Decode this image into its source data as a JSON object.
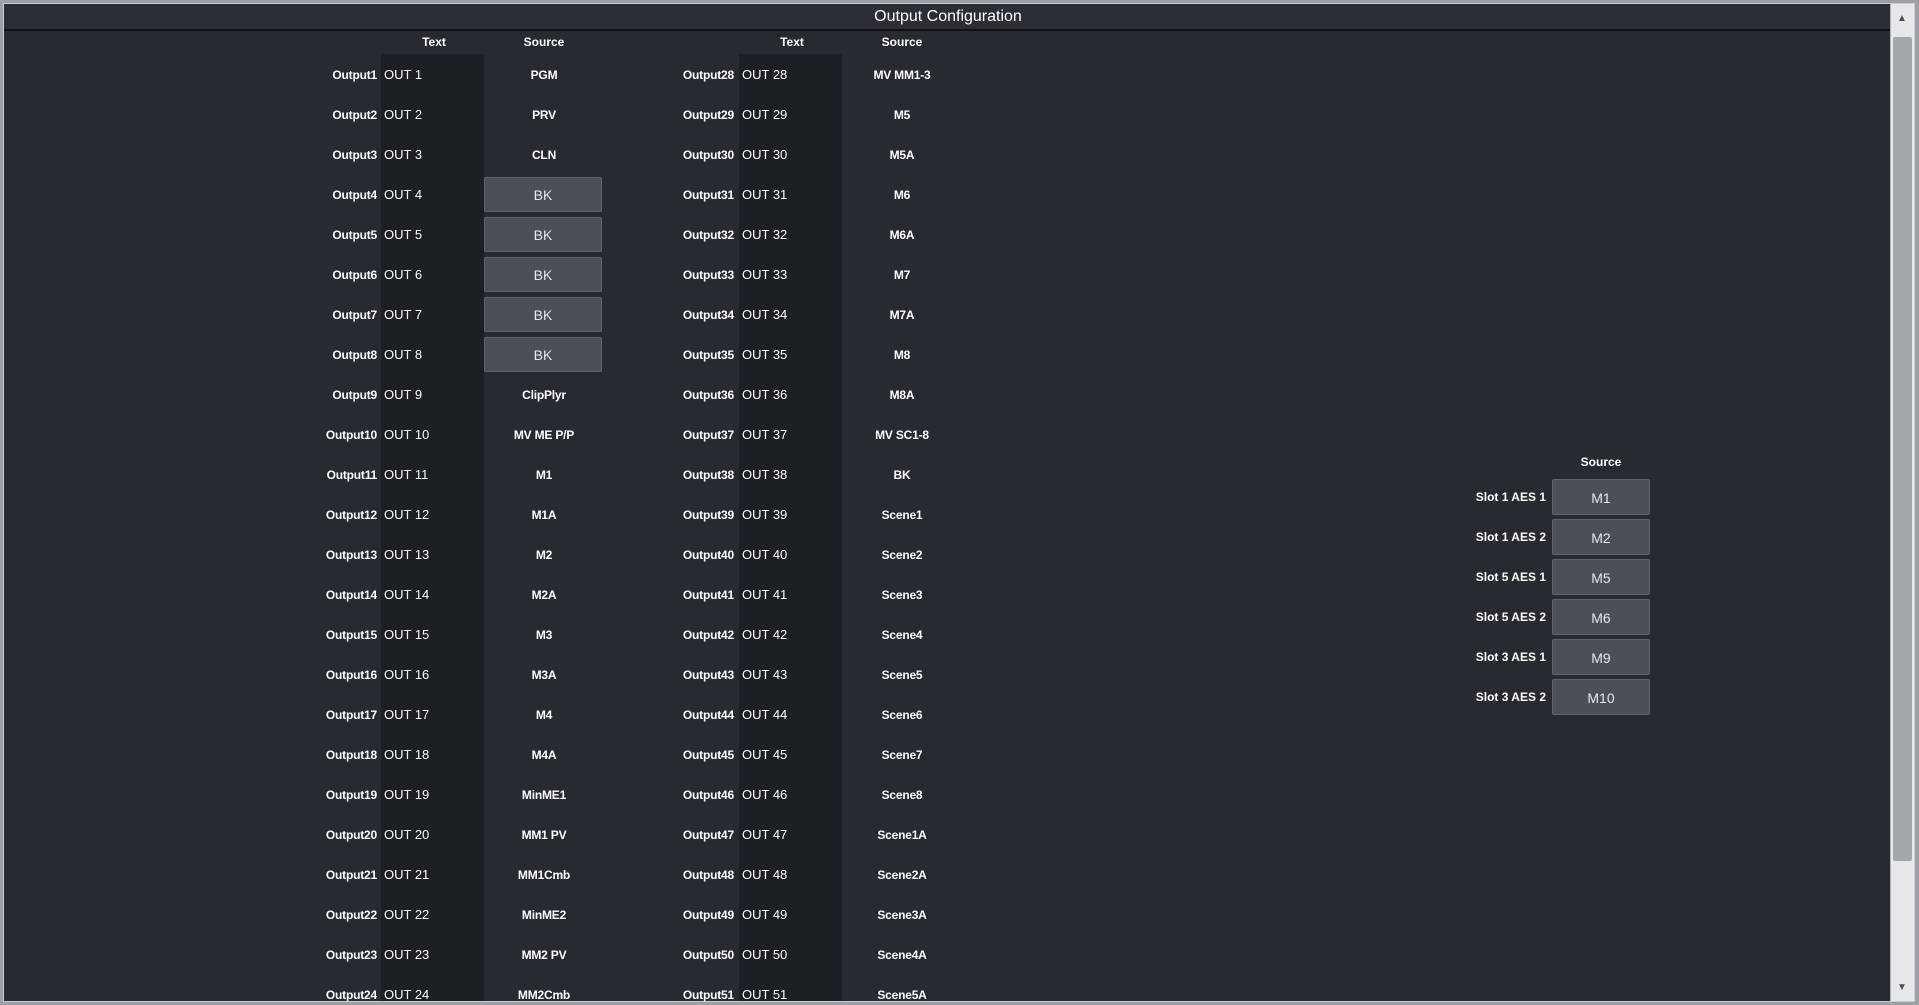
{
  "title": "Output Configuration",
  "columns": {
    "text": "Text",
    "source": "Source"
  },
  "outputsLeft": [
    {
      "label": "Output1",
      "text": "OUT 1",
      "source": "PGM",
      "button": false
    },
    {
      "label": "Output2",
      "text": "OUT 2",
      "source": "PRV",
      "button": false
    },
    {
      "label": "Output3",
      "text": "OUT 3",
      "source": "CLN",
      "button": false
    },
    {
      "label": "Output4",
      "text": "OUT 4",
      "source": "BK",
      "button": true
    },
    {
      "label": "Output5",
      "text": "OUT 5",
      "source": "BK",
      "button": true
    },
    {
      "label": "Output6",
      "text": "OUT 6",
      "source": "BK",
      "button": true
    },
    {
      "label": "Output7",
      "text": "OUT 7",
      "source": "BK",
      "button": true
    },
    {
      "label": "Output8",
      "text": "OUT 8",
      "source": "BK",
      "button": true
    },
    {
      "label": "Output9",
      "text": "OUT 9",
      "source": "ClipPlyr",
      "button": false
    },
    {
      "label": "Output10",
      "text": "OUT 10",
      "source": "MV ME P/P",
      "button": false
    },
    {
      "label": "Output11",
      "text": "OUT 11",
      "source": "M1",
      "button": false
    },
    {
      "label": "Output12",
      "text": "OUT 12",
      "source": "M1A",
      "button": false
    },
    {
      "label": "Output13",
      "text": "OUT 13",
      "source": "M2",
      "button": false
    },
    {
      "label": "Output14",
      "text": "OUT 14",
      "source": "M2A",
      "button": false
    },
    {
      "label": "Output15",
      "text": "OUT 15",
      "source": "M3",
      "button": false
    },
    {
      "label": "Output16",
      "text": "OUT 16",
      "source": "M3A",
      "button": false
    },
    {
      "label": "Output17",
      "text": "OUT 17",
      "source": "M4",
      "button": false
    },
    {
      "label": "Output18",
      "text": "OUT 18",
      "source": "M4A",
      "button": false
    },
    {
      "label": "Output19",
      "text": "OUT 19",
      "source": "MinME1",
      "button": false
    },
    {
      "label": "Output20",
      "text": "OUT 20",
      "source": "MM1 PV",
      "button": false
    },
    {
      "label": "Output21",
      "text": "OUT 21",
      "source": "MM1Cmb",
      "button": false
    },
    {
      "label": "Output22",
      "text": "OUT 22",
      "source": "MinME2",
      "button": false
    },
    {
      "label": "Output23",
      "text": "OUT 23",
      "source": "MM2 PV",
      "button": false
    },
    {
      "label": "Output24",
      "text": "OUT 24",
      "source": "MM2Cmb",
      "button": false
    }
  ],
  "outputsRight": [
    {
      "label": "Output28",
      "text": "OUT 28",
      "source": "MV MM1-3"
    },
    {
      "label": "Output29",
      "text": "OUT 29",
      "source": "M5"
    },
    {
      "label": "Output30",
      "text": "OUT 30",
      "source": "M5A"
    },
    {
      "label": "Output31",
      "text": "OUT 31",
      "source": "M6"
    },
    {
      "label": "Output32",
      "text": "OUT 32",
      "source": "M6A"
    },
    {
      "label": "Output33",
      "text": "OUT 33",
      "source": "M7"
    },
    {
      "label": "Output34",
      "text": "OUT 34",
      "source": "M7A"
    },
    {
      "label": "Output35",
      "text": "OUT 35",
      "source": "M8"
    },
    {
      "label": "Output36",
      "text": "OUT 36",
      "source": "M8A"
    },
    {
      "label": "Output37",
      "text": "OUT 37",
      "source": "MV SC1-8"
    },
    {
      "label": "Output38",
      "text": "OUT 38",
      "source": "BK"
    },
    {
      "label": "Output39",
      "text": "OUT 39",
      "source": "Scene1"
    },
    {
      "label": "Output40",
      "text": "OUT 40",
      "source": "Scene2"
    },
    {
      "label": "Output41",
      "text": "OUT 41",
      "source": "Scene3"
    },
    {
      "label": "Output42",
      "text": "OUT 42",
      "source": "Scene4"
    },
    {
      "label": "Output43",
      "text": "OUT 43",
      "source": "Scene5"
    },
    {
      "label": "Output44",
      "text": "OUT 44",
      "source": "Scene6"
    },
    {
      "label": "Output45",
      "text": "OUT 45",
      "source": "Scene7"
    },
    {
      "label": "Output46",
      "text": "OUT 46",
      "source": "Scene8"
    },
    {
      "label": "Output47",
      "text": "OUT 47",
      "source": "Scene1A"
    },
    {
      "label": "Output48",
      "text": "OUT 48",
      "source": "Scene2A"
    },
    {
      "label": "Output49",
      "text": "OUT 49",
      "source": "Scene3A"
    },
    {
      "label": "Output50",
      "text": "OUT 50",
      "source": "Scene4A"
    },
    {
      "label": "Output51",
      "text": "OUT 51",
      "source": "Scene5A"
    }
  ],
  "aes": [
    {
      "label": "Slot 1 AES 1",
      "source": "M1"
    },
    {
      "label": "Slot 1 AES 2",
      "source": "M2"
    },
    {
      "label": "Slot 5 AES 1",
      "source": "M5"
    },
    {
      "label": "Slot 5 AES 2",
      "source": "M6"
    },
    {
      "label": "Slot 3 AES 1",
      "source": "M9"
    },
    {
      "label": "Slot 3 AES 2",
      "source": "M10"
    }
  ]
}
